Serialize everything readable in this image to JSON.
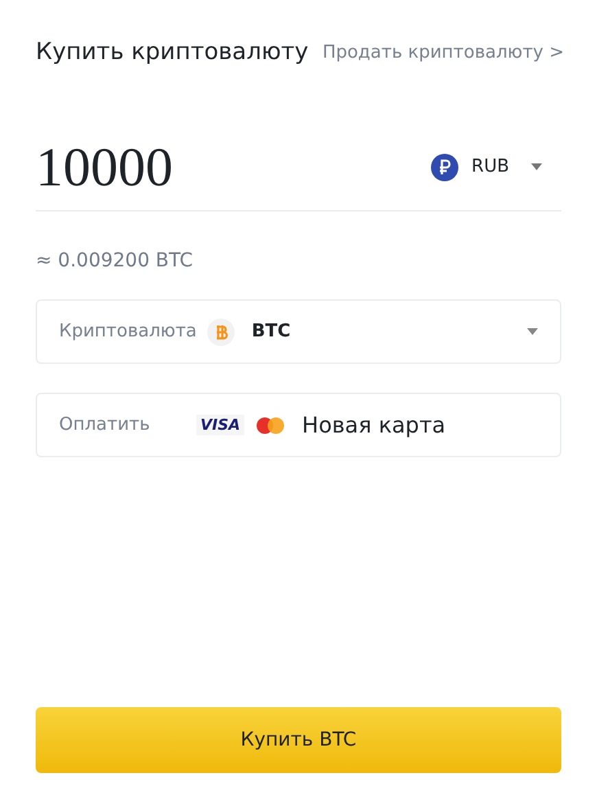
{
  "header": {
    "title": "Купить криптовалюту",
    "sell_link": "Продать криптовалюту >"
  },
  "amount": {
    "value": "10000",
    "currency": "RUB"
  },
  "estimate": "≈ 0.009200 BTC",
  "crypto_select": {
    "label": "Криптовалюта",
    "value": "BTC"
  },
  "payment": {
    "label": "Оплатить",
    "card_brand": "VISA",
    "value": "Новая карта"
  },
  "buy_button": "Купить BTC"
}
